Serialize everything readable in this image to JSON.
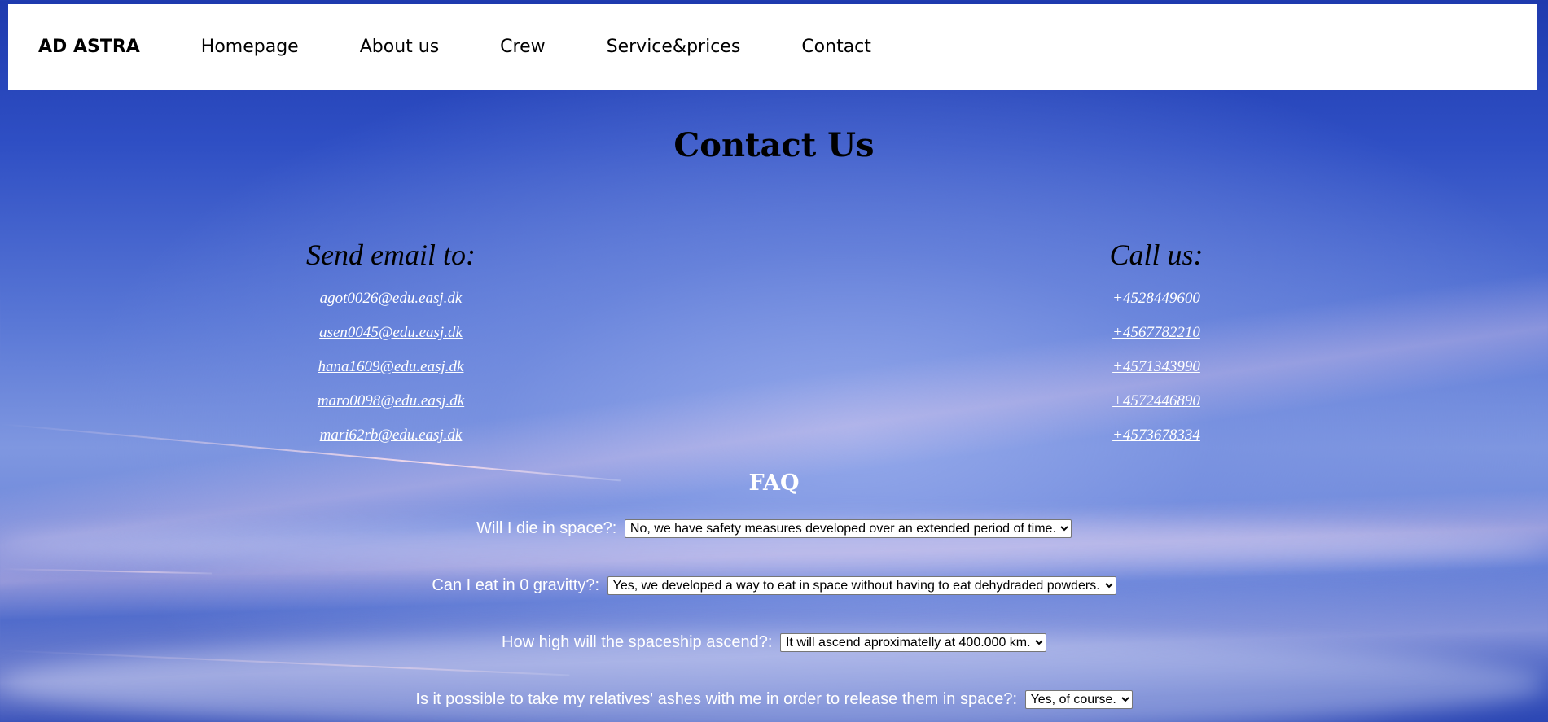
{
  "nav": {
    "brand": "AD ASTRA",
    "links": [
      "Homepage",
      "About us",
      "Crew",
      "Service&prices",
      "Contact"
    ]
  },
  "page_title": "Contact Us",
  "email_section": {
    "heading": "Send email to:",
    "emails": [
      "agot0026@edu.easj.dk",
      "asen0045@edu.easj.dk",
      "hana1609@edu.easj.dk",
      "maro0098@edu.easj.dk",
      "mari62rb@edu.easj.dk"
    ]
  },
  "phone_section": {
    "heading": "Call us:",
    "phones": [
      "+4528449600",
      "+4567782210",
      "+4571343990",
      "+4572446890",
      "+4573678334"
    ]
  },
  "faq": {
    "title": "FAQ",
    "items": [
      {
        "question": "Will I die in space?:",
        "answer": "No, we have safety measures developed over an extended period of time."
      },
      {
        "question": "Can I eat in 0 gravitty?:",
        "answer": "Yes, we developed a way to eat in space without having to eat dehydraded powders."
      },
      {
        "question": "How high will the spaceship ascend?:",
        "answer": "It will ascend aproximatelly at 400.000 km."
      },
      {
        "question": "Is it possible to take my relatives' ashes with me in order to release them in space?:",
        "answer": "Yes, of course."
      }
    ]
  }
}
